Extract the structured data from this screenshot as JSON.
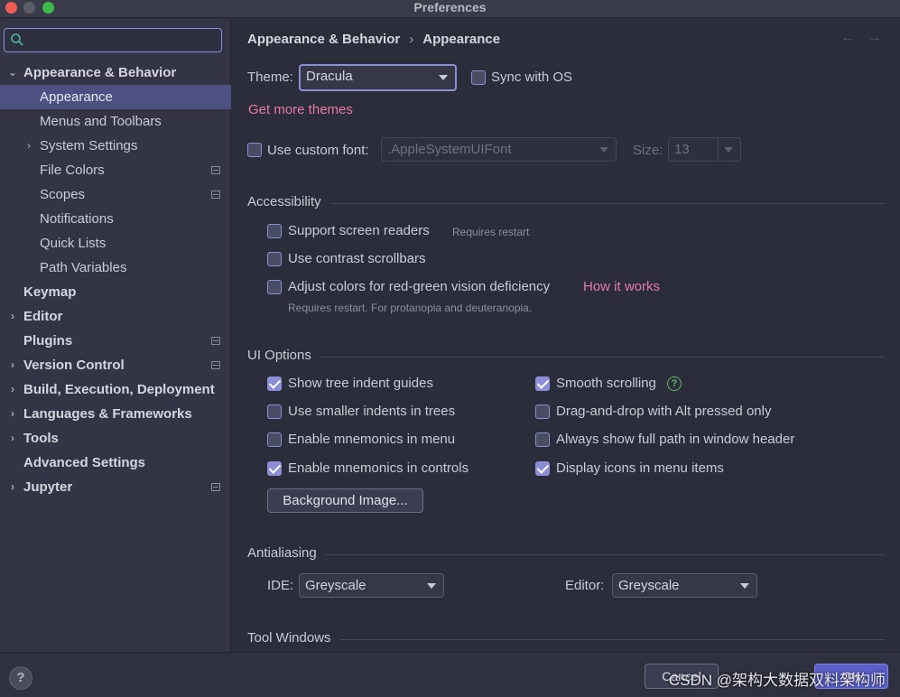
{
  "window": {
    "title": "Preferences"
  },
  "sidebar": {
    "search": {
      "placeholder": "",
      "value": ""
    },
    "items": [
      {
        "label": "Appearance & Behavior",
        "bold": true,
        "expanded": true,
        "chevron": "⌄"
      },
      {
        "label": "Appearance",
        "selected": true
      },
      {
        "label": "Menus and Toolbars"
      },
      {
        "label": "System Settings",
        "chevron": "›"
      },
      {
        "label": "File Colors",
        "badge": true
      },
      {
        "label": "Scopes",
        "badge": true
      },
      {
        "label": "Notifications"
      },
      {
        "label": "Quick Lists"
      },
      {
        "label": "Path Variables"
      },
      {
        "label": "Keymap",
        "bold": true
      },
      {
        "label": "Editor",
        "bold": true,
        "chevron": "›"
      },
      {
        "label": "Plugins",
        "bold": true,
        "badge": true
      },
      {
        "label": "Version Control",
        "bold": true,
        "chevron": "›",
        "badge": true
      },
      {
        "label": "Build, Execution, Deployment",
        "bold": true,
        "chevron": "›"
      },
      {
        "label": "Languages & Frameworks",
        "bold": true,
        "chevron": "›"
      },
      {
        "label": "Tools",
        "bold": true,
        "chevron": "›"
      },
      {
        "label": "Advanced Settings",
        "bold": true
      },
      {
        "label": "Jupyter",
        "bold": true,
        "chevron": "›",
        "badge": true
      }
    ]
  },
  "breadcrumb": {
    "parent": "Appearance & Behavior",
    "separator": "›",
    "current": "Appearance"
  },
  "nav": {
    "back": "←",
    "forward": "→"
  },
  "theme": {
    "label": "Theme:",
    "value": "Dracula",
    "sync_label": "Sync with OS",
    "sync_checked": false,
    "more_themes": "Get more themes"
  },
  "custom_font": {
    "label": "Use custom font:",
    "checked": false,
    "value": ".AppleSystemUIFont",
    "size_label": "Size:",
    "size_value": "13"
  },
  "accessibility": {
    "title": "Accessibility",
    "screen_readers": {
      "label": "Support screen readers",
      "note": "Requires restart",
      "checked": false
    },
    "contrast_scrollbars": {
      "label": "Use contrast scrollbars",
      "checked": false
    },
    "color_adjust": {
      "label": "Adjust colors for red-green vision deficiency",
      "link": "How it works",
      "note": "Requires restart. For protanopia and deuteranopia.",
      "checked": false
    }
  },
  "ui_options": {
    "title": "UI Options",
    "left": [
      {
        "label": "Show tree indent guides",
        "checked": true
      },
      {
        "label": "Use smaller indents in trees",
        "checked": false
      },
      {
        "label": "Enable mnemonics in menu",
        "checked": false
      },
      {
        "label": "Enable mnemonics in controls",
        "checked": true
      }
    ],
    "right": [
      {
        "label": "Smooth scrolling",
        "checked": true,
        "help": "?"
      },
      {
        "label": "Drag-and-drop with Alt pressed only",
        "checked": false
      },
      {
        "label": "Always show full path in window header",
        "checked": false
      },
      {
        "label": "Display icons in menu items",
        "checked": true
      }
    ],
    "background_button": "Background Image..."
  },
  "antialiasing": {
    "title": "Antialiasing",
    "ide_label": "IDE:",
    "ide_value": "Greyscale",
    "editor_label": "Editor:",
    "editor_value": "Greyscale"
  },
  "tool_windows": {
    "title": "Tool Windows"
  },
  "footer": {
    "help": "?",
    "cancel": "Cancel",
    "ok": "OK",
    "watermark": "CSDN @架构大数据双料架构师"
  },
  "colors": {
    "accent": "#8c8fd8",
    "selection": "#4c5181",
    "link": "#e47aa7",
    "background": "#2b2d3a",
    "sidebar": "#333546"
  }
}
